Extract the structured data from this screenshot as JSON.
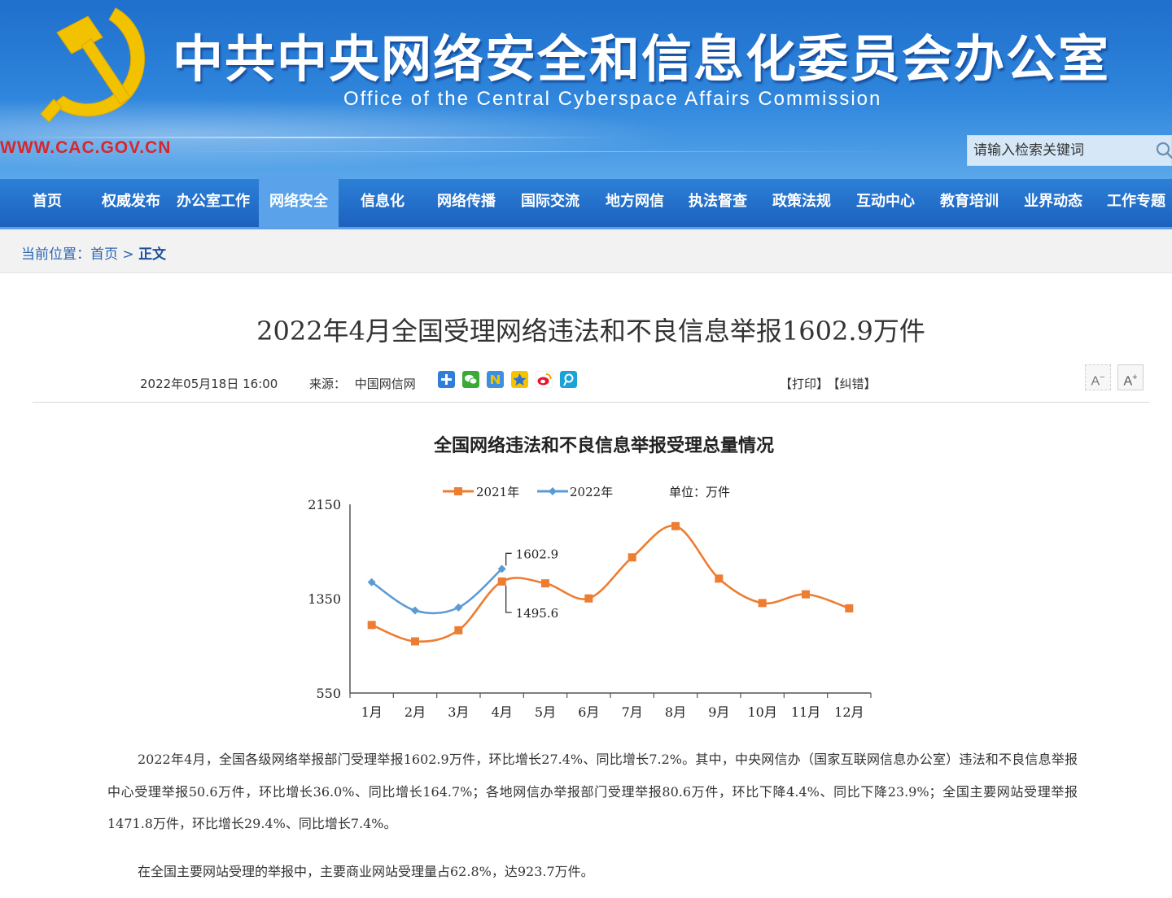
{
  "header": {
    "title": "中共中央网络安全和信息化委员会办公室",
    "subtitle": "Office of the Central Cyberspace Affairs Commission",
    "url": "WWW.CAC.GOV.CN",
    "search_placeholder": "请输入检索关键词",
    "colors": {
      "banner": "#2f86dc",
      "emblem": "#f2c200",
      "url": "#d8262c"
    }
  },
  "nav": {
    "items": [
      {
        "label": "首页"
      },
      {
        "label": "权威发布"
      },
      {
        "label": "办公室工作"
      },
      {
        "label": "网络安全",
        "active": true
      },
      {
        "label": "信息化"
      },
      {
        "label": "网络传播"
      },
      {
        "label": "国际交流"
      },
      {
        "label": "地方网信"
      },
      {
        "label": "执法督查"
      },
      {
        "label": "政策法规"
      },
      {
        "label": "互动中心"
      },
      {
        "label": "教育培训"
      },
      {
        "label": "业界动态"
      },
      {
        "label": "工作专题"
      }
    ]
  },
  "breadcrumb": {
    "prefix": "当前位置：",
    "home": "首页",
    "sep": ">",
    "current": "正文"
  },
  "article": {
    "title": "2022年4月全国受理网络违法和不良信息举报1602.9万件",
    "date": "2022年05月18日 16:00",
    "source_label": "来源：",
    "source": "中国网信网",
    "print": "【打印】",
    "correct": "【纠错】",
    "font_smaller": "A",
    "font_larger": "A",
    "share_icons": [
      "plus-share-icon",
      "wechat-icon",
      "renren-icon",
      "qzone-icon",
      "weibo-icon",
      "tencent-weibo-icon"
    ],
    "paragraphs": [
      "2022年4月，全国各级网络举报部门受理举报1602.9万件，环比增长27.4%、同比增长7.2%。其中，中央网信办（国家互联网信息办公室）违法和不良信息举报中心受理举报50.6万件，环比增长36.0%、同比增长164.7%；各地网信办举报部门受理举报80.6万件，环比下降4.4%、同比下降23.9%；全国主要网站受理举报1471.8万件，环比增长29.4%、同比增长7.4%。",
      "在全国主要网站受理的举报中，主要商业网站受理量占62.8%，达923.7万件。"
    ]
  },
  "chart_data": {
    "type": "line",
    "title": "全国网络违法和不良信息举报受理总量情况",
    "unit": "单位：万件",
    "categories": [
      "1月",
      "2月",
      "3月",
      "4月",
      "5月",
      "6月",
      "7月",
      "8月",
      "9月",
      "10月",
      "11月",
      "12月"
    ],
    "series": [
      {
        "name": "2021年",
        "color": "#ed7d31",
        "values": [
          1127,
          988,
          1082,
          1495.6,
          1480,
          1352,
          1700,
          1965,
          1520,
          1313,
          1387,
          1268
        ]
      },
      {
        "name": "2022年",
        "color": "#5b9bd5",
        "values": [
          1490,
          1250,
          1275,
          1602.9
        ]
      }
    ],
    "ylim": [
      550,
      2150
    ],
    "yticks": [
      "550",
      "1350",
      "2150"
    ],
    "annotations": [
      {
        "text": "1602.9",
        "series": 1,
        "index": 3
      },
      {
        "text": "1495.6",
        "series": 0,
        "index": 3
      }
    ],
    "legend": "top",
    "grid": false
  }
}
